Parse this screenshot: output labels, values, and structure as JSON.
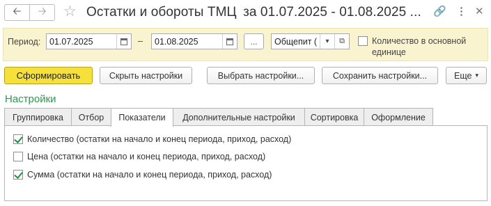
{
  "window": {
    "title": "Остатки и обороты ТМЦ",
    "title_dates": "за 01.07.2025 - 01.08.2025 ...",
    "icons": [
      "back-arrow-icon",
      "forward-arrow-icon",
      "star-icon",
      "link-icon",
      "more-vertical-icon",
      "close-icon"
    ],
    "back_glyph": "🡠",
    "forward_glyph": "🡢",
    "star_glyph": "☆",
    "link_glyph": "🔗",
    "more_glyph": "⋮",
    "close_glyph": "✕"
  },
  "params": {
    "period_label": "Период:",
    "date_from": "01.07.2025",
    "dash": "–",
    "date_to": "01.08.2025",
    "choose_period_label": "...",
    "org_value": "Общепит (",
    "dropdown_glyph": "▾",
    "open_glyph": "⧉",
    "base_unit_label": "Количество в основной единице",
    "base_unit_checked": false
  },
  "toolbar": {
    "generate": "Сформировать",
    "hide_settings": "Скрыть настройки",
    "choose_settings": "Выбрать настройки...",
    "save_settings": "Сохранить настройки...",
    "more": "Еще",
    "more_glyph": "▾"
  },
  "settings": {
    "heading": "Настройки",
    "tabs": [
      {
        "label": "Группировка",
        "active": false
      },
      {
        "label": "Отбор",
        "active": false
      },
      {
        "label": "Показатели",
        "active": true
      },
      {
        "label": "Дополнительные настройки",
        "active": false
      },
      {
        "label": "Сортировка",
        "active": false
      },
      {
        "label": "Оформление",
        "active": false
      }
    ],
    "indicators": [
      {
        "label": "Количество (остатки на начало и конец периода, приход, расход)",
        "checked": true
      },
      {
        "label": "Цена (остатки на начало и конец периода, приход, расход)",
        "checked": false
      },
      {
        "label": "Сумма (остатки на начало и конец периода, приход, расход)",
        "checked": true
      }
    ]
  },
  "colors": {
    "accent_green": "#2b9a4b",
    "primary_button": "#f6e03a",
    "params_background": "#faf3cf"
  }
}
